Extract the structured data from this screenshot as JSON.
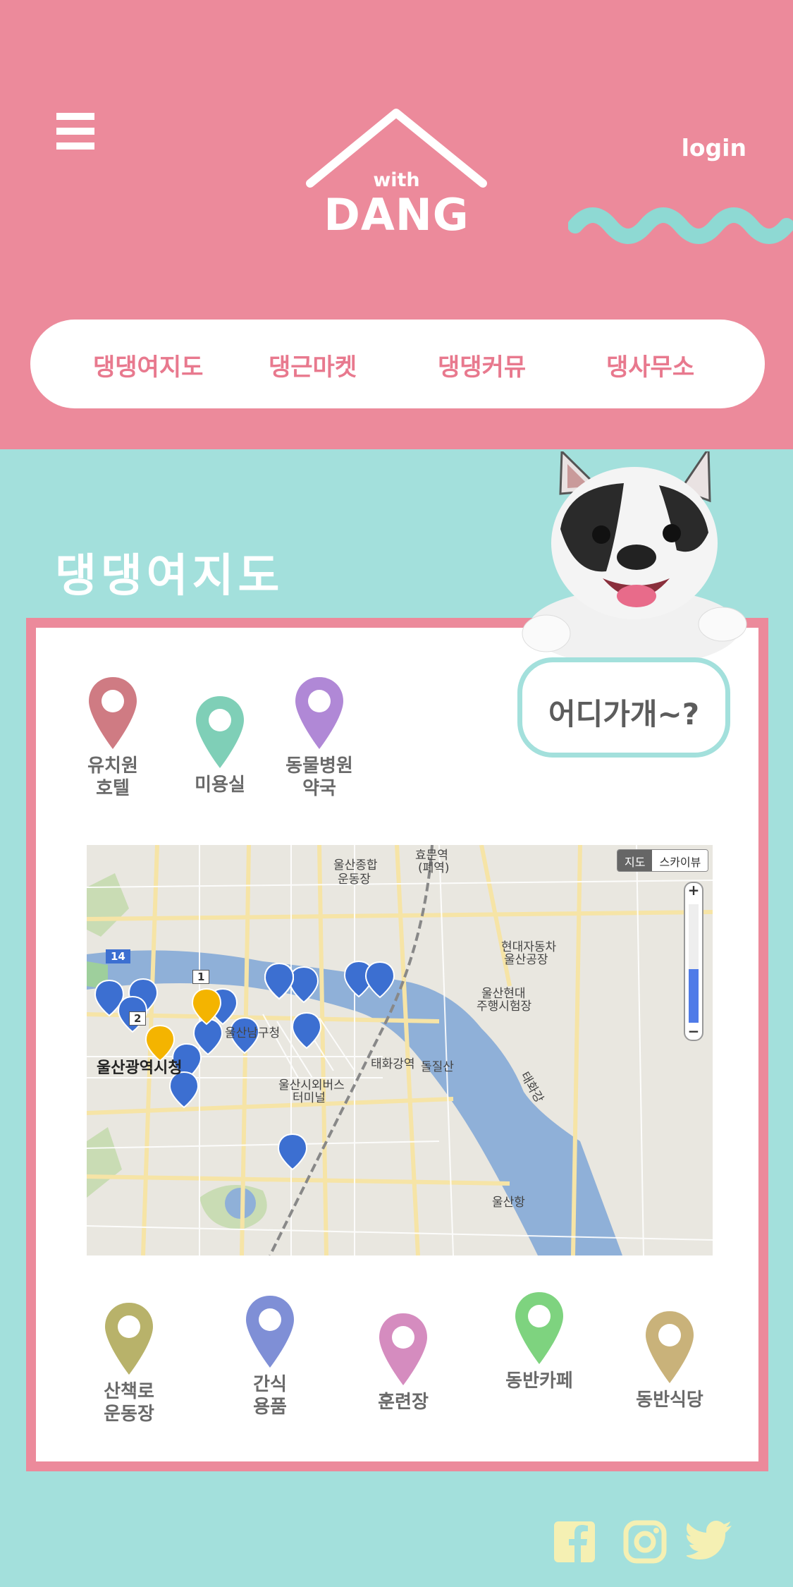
{
  "header": {
    "logo_small": "with",
    "logo_big": "DANG",
    "login_label": "login"
  },
  "nav": {
    "items": [
      {
        "label": "댕댕여지도"
      },
      {
        "label": "댕근마켓"
      },
      {
        "label": "댕댕커뮤"
      },
      {
        "label": "댕사무소"
      }
    ]
  },
  "section": {
    "title": "댕댕여지도",
    "bubble_text": "어디가개~?"
  },
  "top_categories": [
    {
      "label_1": "유치원",
      "label_2": "호텔",
      "color": "#cf7b83",
      "icon": "map-pin-icon"
    },
    {
      "label_1": "",
      "label_2": "미용실",
      "color": "#7fcfb7",
      "icon": "map-pin-icon"
    },
    {
      "label_1": "동물병원",
      "label_2": "약국",
      "color": "#b088d6",
      "icon": "map-pin-icon"
    }
  ],
  "bottom_categories": [
    {
      "label_1": "산책로",
      "label_2": "운동장",
      "color": "#b8b26a",
      "icon": "map-pin-icon"
    },
    {
      "label_1": "간식",
      "label_2": "용품",
      "color": "#7f8fd6",
      "icon": "map-pin-icon"
    },
    {
      "label_1": "",
      "label_2": "훈련장",
      "color": "#d58cbf",
      "icon": "map-pin-icon"
    },
    {
      "label_1": "",
      "label_2": "동반카페",
      "color": "#7ed37f",
      "icon": "map-pin-icon"
    },
    {
      "label_1": "",
      "label_2": "동반식당",
      "color": "#c9b27a",
      "icon": "map-pin-icon"
    }
  ],
  "map": {
    "toggle_map": "지도",
    "toggle_sky": "스카이뷰",
    "zoom_plus": "+",
    "zoom_minus": "−",
    "route_1": "1",
    "route_2": "2",
    "route_14": "14",
    "labels": {
      "city_hall": "울산광역시청",
      "namgu": "울산남구청",
      "sports": "울산종합",
      "sports2": "운동장",
      "hyundai_car": "현대자동차",
      "hyundai_car2": "울산공장",
      "hyundai_test": "울산현대",
      "hyundai_test2": "주행시험장",
      "taehwa_station": "태화강역",
      "bus_terminal": "울산시외버스",
      "bus_terminal2": "터미널",
      "dolgilsan": "돌질산",
      "taehwa_river": "태화강",
      "port": "울산항",
      "hyomun": "효문역",
      "hyomun2": "(폐역)"
    }
  },
  "colors": {
    "header_bg": "#ec8a9b",
    "body_bg": "#a3e0dc",
    "nav_text": "#e8798e",
    "social_icon": "#f5f0b3"
  },
  "social": [
    {
      "icon": "facebook-icon"
    },
    {
      "icon": "instagram-icon"
    },
    {
      "icon": "twitter-icon"
    }
  ]
}
